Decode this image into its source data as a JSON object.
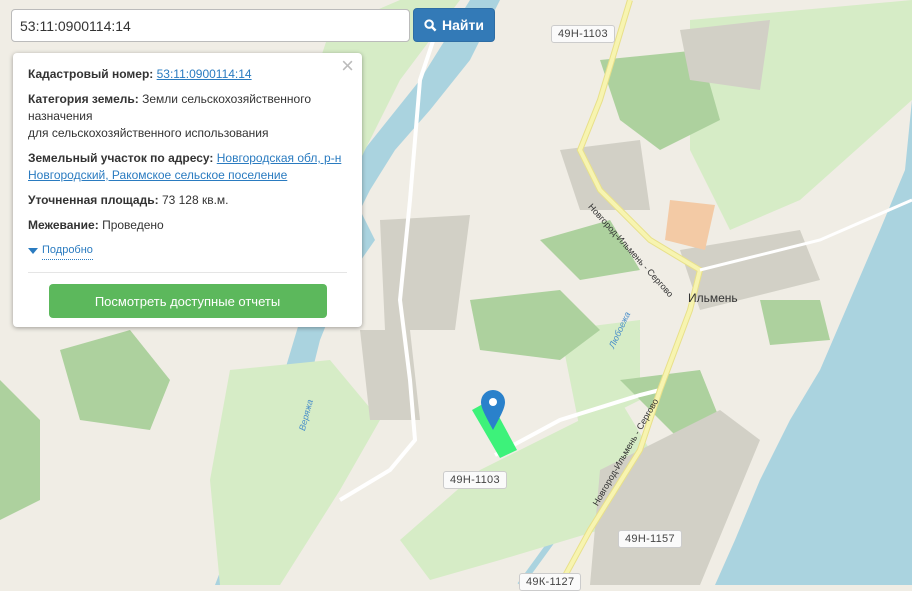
{
  "search": {
    "value": "53:11:0900114:14",
    "button": "Найти",
    "icon": "search-icon"
  },
  "info": {
    "cadastral_label": "Кадастровый номер:",
    "cadastral_value": "53:11:0900114:14",
    "category_label": "Категория земель:",
    "category_value": "Земли сельскохозяйственного назначения",
    "category_value2": "для сельскохозяйственного использования",
    "address_label": "Земельный участок по адресу:",
    "address_value": "Новгородская обл, р-н Новгородский, Ракомское сельское поселение",
    "area_label": "Уточненная площадь:",
    "area_value": "73 128 кв.м.",
    "survey_label": "Межевание:",
    "survey_value": "Проведено",
    "more": "Подробно",
    "report_button": "Посмотреть доступные отчеты",
    "close": "×"
  },
  "map": {
    "shields": [
      "49Н-1103",
      "49Н-1103",
      "49Н-1157",
      "49К-1127"
    ],
    "place": "Ильмень",
    "road": "Новгород-Ильмень - Сергово",
    "rivers": [
      "Веряжа",
      "Любоежа"
    ],
    "colors": {
      "water": "#aad3df",
      "forest": "#add19e",
      "parcel": "#3df27a",
      "marker": "#2a81cb"
    }
  }
}
